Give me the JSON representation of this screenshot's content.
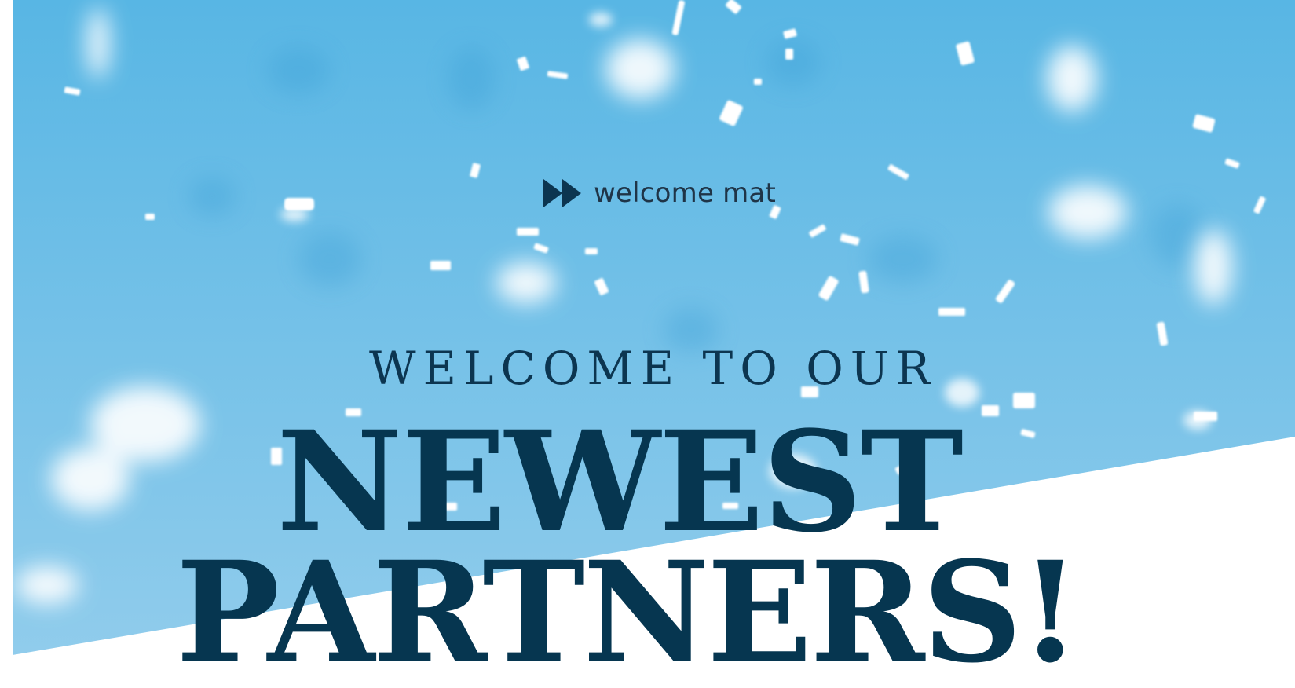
{
  "hero": {
    "colors": {
      "sky_top": "#5cb8e4",
      "sky_bottom": "#8fcdee",
      "confetti": "#ffffff",
      "text": "#063650"
    }
  },
  "kicker": {
    "icon": "double-chevron-right-icon",
    "label": "welcome mat"
  },
  "heading": {
    "subtitle": "WELCOME TO OUR",
    "line1": "NEWEST",
    "line2": "PARTNERS!"
  }
}
